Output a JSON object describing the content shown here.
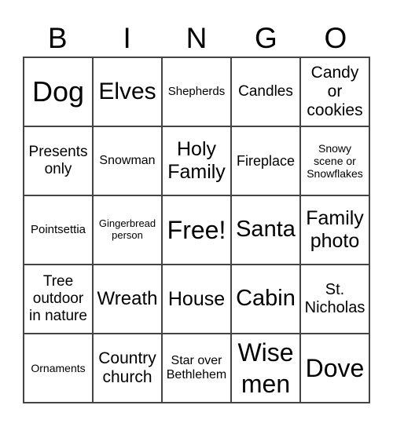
{
  "header": [
    "B",
    "I",
    "N",
    "G",
    "O"
  ],
  "cells": [
    "Dog",
    "Elves",
    "Shepherds",
    "Candles",
    "Candy or cookies",
    "Presents only",
    "Snowman",
    "Holy Family",
    "Fireplace",
    "Snowy scene or Snowflakes",
    "Pointsettia",
    "Gingerbread person",
    "Free!",
    "Santa",
    "Family photo",
    "Tree outdoor in nature",
    "Wreath",
    "House",
    "Cabin",
    "St. Nicholas",
    "Ornaments",
    "Country church",
    "Star over Bethlehem",
    "Wise men",
    "Dove"
  ]
}
